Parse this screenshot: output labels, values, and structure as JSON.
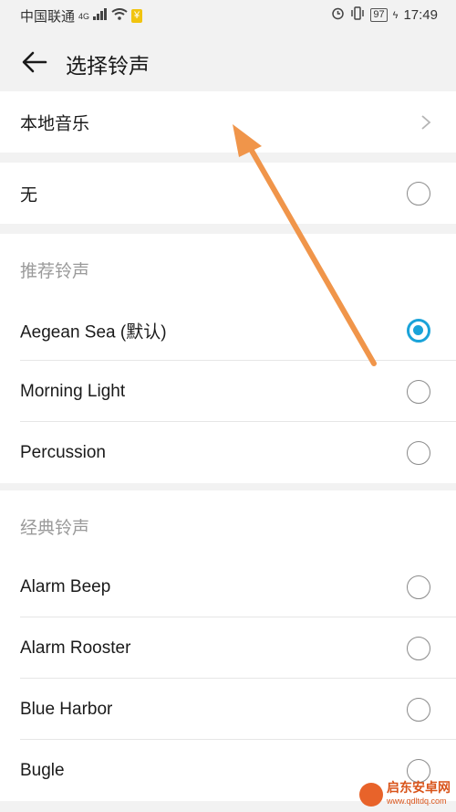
{
  "status_bar": {
    "carrier": "中国联通",
    "network": "4G",
    "pay_badge": "¥",
    "battery": "97",
    "time": "17:49"
  },
  "header": {
    "back_icon": "arrow-left-icon",
    "title": "选择铃声"
  },
  "local_music": {
    "label": "本地音乐",
    "icon": "chevron-right-icon"
  },
  "none_option": {
    "label": "无",
    "selected": false
  },
  "sections": [
    {
      "title": "推荐铃声",
      "items": [
        {
          "label": "Aegean Sea (默认)",
          "selected": true
        },
        {
          "label": "Morning Light",
          "selected": false
        },
        {
          "label": "Percussion",
          "selected": false
        }
      ]
    },
    {
      "title": "经典铃声",
      "items": [
        {
          "label": "Alarm Beep",
          "selected": false
        },
        {
          "label": "Alarm Rooster",
          "selected": false
        },
        {
          "label": "Blue Harbor",
          "selected": false
        },
        {
          "label": "Bugle",
          "selected": false
        }
      ]
    }
  ],
  "annotation": {
    "arrow_color": "#f0954a"
  },
  "watermark": {
    "text": "启东安卓网",
    "url": "www.qdltdq.com"
  }
}
